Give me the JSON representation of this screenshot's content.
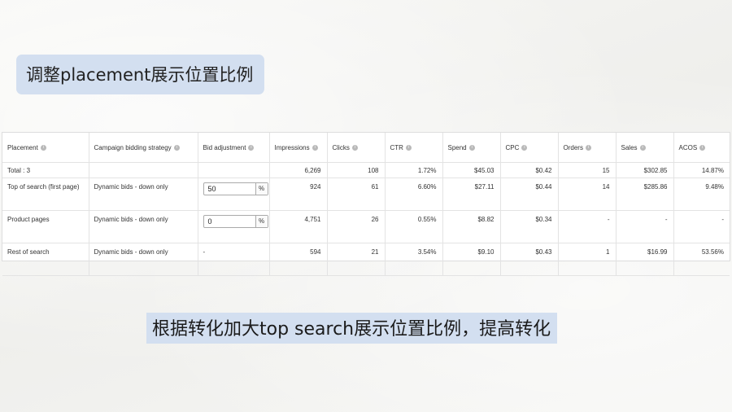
{
  "slide": {
    "title": "调整placement展示位置比例",
    "bottom_text": "根据转化加大top search展示位置比例，提高转化"
  },
  "table": {
    "headers": [
      "Placement",
      "Campaign bidding strategy",
      "Bid adjustment",
      "Impressions",
      "Clicks",
      "CTR",
      "Spend",
      "CPC",
      "Orders",
      "Sales",
      "ACOS"
    ],
    "info_icon": "info-icon",
    "total": {
      "label": "Total : 3",
      "impressions": "6,269",
      "clicks": "108",
      "ctr": "1.72%",
      "spend": "$45.03",
      "cpc": "$0.42",
      "orders": "15",
      "sales": "$302.85",
      "acos": "14.87%"
    },
    "rows": [
      {
        "placement": "Top of search (first page)",
        "strategy": "Dynamic bids - down only",
        "bid": "50",
        "pct": "%",
        "impressions": "924",
        "clicks": "61",
        "ctr": "6.60%",
        "spend": "$27.11",
        "cpc": "$0.44",
        "orders": "14",
        "sales": "$285.86",
        "acos": "9.48%"
      },
      {
        "placement": "Product pages",
        "strategy": "Dynamic bids - down only",
        "bid": "0",
        "pct": "%",
        "impressions": "4,751",
        "clicks": "26",
        "ctr": "0.55%",
        "spend": "$8.82",
        "cpc": "$0.34",
        "orders": "-",
        "sales": "-",
        "acos": "-"
      },
      {
        "placement": "Rest of search",
        "strategy": "Dynamic bids - down only",
        "bid_text": "-",
        "impressions": "594",
        "clicks": "21",
        "ctr": "3.54%",
        "spend": "$9.10",
        "cpc": "$0.43",
        "orders": "1",
        "sales": "$16.99",
        "acos": "53.56%"
      }
    ]
  }
}
